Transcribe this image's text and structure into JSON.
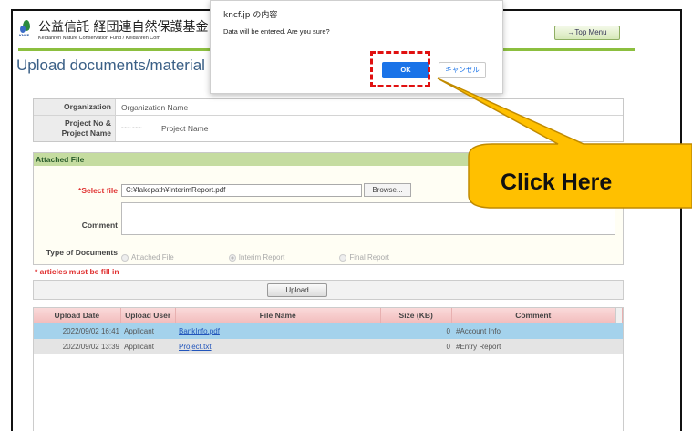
{
  "header": {
    "org_title": "公益信託 経団連自然保護基金 /",
    "org_subtitle": "Keidanren Nature Conservation Fund / Keidanren Com",
    "logo_text": "KNCF",
    "top_menu_label": "→Top Menu"
  },
  "page_title": "Upload documents/material",
  "info": {
    "organization_label": "Organization",
    "organization_value": "Organization Name",
    "project_label": "Project No & Project Name",
    "project_no": "~~~ ~~~",
    "project_name": "Project Name"
  },
  "attached": {
    "header": "Attached File",
    "select_file_required_mark": "*",
    "select_file_label": "Select file",
    "file_path": "C:¥fakepath¥InterimReport.pdf",
    "browse_label": "Browse...",
    "comment_label": "Comment",
    "comment_value": "",
    "type_label": "Type of Documents",
    "type_options": [
      {
        "label": "Attached File",
        "selected": false
      },
      {
        "label": "Interim Report",
        "selected": true
      },
      {
        "label": "Final Report",
        "selected": false
      }
    ]
  },
  "required_note": "* articles must be fill in",
  "upload_label": "Upload",
  "file_list": {
    "columns": [
      "Upload Date",
      "Upload User",
      "File Name",
      "Size (KB)",
      "Comment"
    ],
    "rows": [
      {
        "date": "2022/09/02 16:41",
        "user": "Applicant",
        "file": "BankInfo.pdf",
        "size": "0",
        "comment": "#Account Info"
      },
      {
        "date": "2022/09/02 13:39",
        "user": "Applicant",
        "file": "Project.txt",
        "size": "0",
        "comment": "#Entry Report"
      }
    ]
  },
  "dialog": {
    "title": "kncf.jp の内容",
    "message": "Data will be entered. Are you sure?",
    "ok_label": "OK",
    "cancel_label": "キャンセル"
  },
  "callout": {
    "text": "Click Here",
    "fill_color": "#ffc000",
    "border_color": "#c08a00",
    "highlight_color": "#e01010"
  }
}
